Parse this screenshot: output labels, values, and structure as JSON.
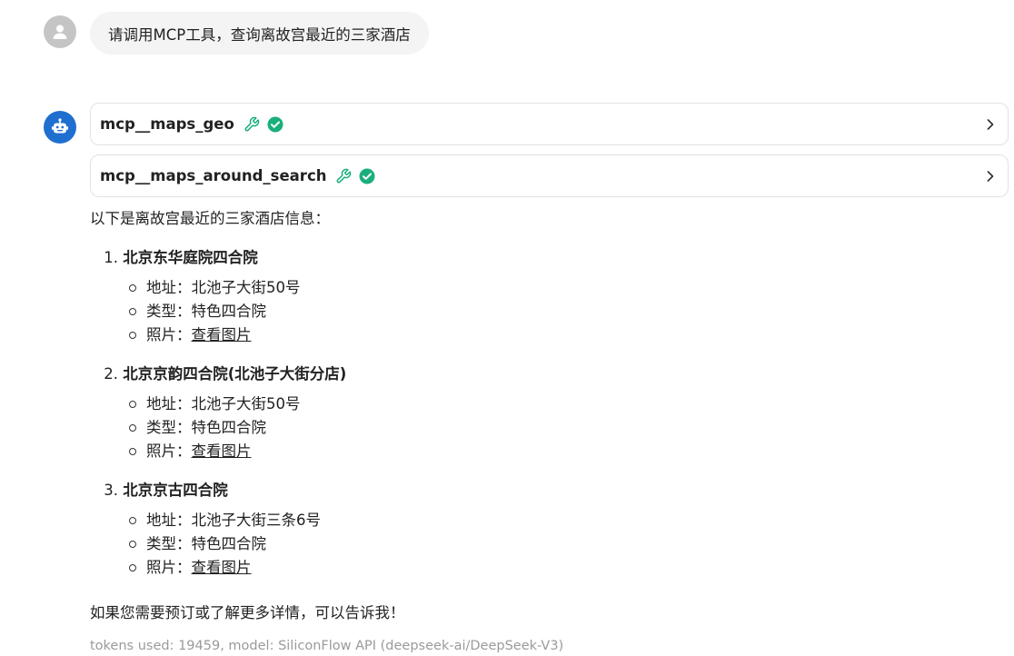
{
  "user_message": "请调用MCP工具，查询离故宫最近的三家酒店",
  "tool_calls": [
    {
      "name": "mcp__maps_geo",
      "status": "success"
    },
    {
      "name": "mcp__maps_around_search",
      "status": "success"
    }
  ],
  "reply": {
    "intro": "以下是离故宫最近的三家酒店信息：",
    "hotels": [
      {
        "num": "1.",
        "name": "北京东华庭院四合院",
        "address_label": "地址：",
        "address": "北池子大街50号",
        "type_label": "类型：",
        "type": "特色四合院",
        "photo_label": "照片：",
        "photo_link": "查看图片"
      },
      {
        "num": "2.",
        "name": "北京京韵四合院(北池子大街分店)",
        "address_label": "地址：",
        "address": "北池子大街50号",
        "type_label": "类型：",
        "type": "特色四合院",
        "photo_label": "照片：",
        "photo_link": "查看图片"
      },
      {
        "num": "3.",
        "name": "北京京古四合院",
        "address_label": "地址：",
        "address": "北池子大街三条6号",
        "type_label": "类型：",
        "type": "特色四合院",
        "photo_label": "照片：",
        "photo_link": "查看图片"
      }
    ],
    "closing": "如果您需要预订或了解更多详情，可以告诉我！"
  },
  "tokens_info": "tokens used: 19459, model: SiliconFlow API (deepseek-ai/DeepSeek-V3)",
  "colors": {
    "bot_avatar": "#1f6fd1",
    "user_avatar": "#c5c5c5",
    "success": "#1aaf7a",
    "user_bubble": "#f4f4f4"
  }
}
